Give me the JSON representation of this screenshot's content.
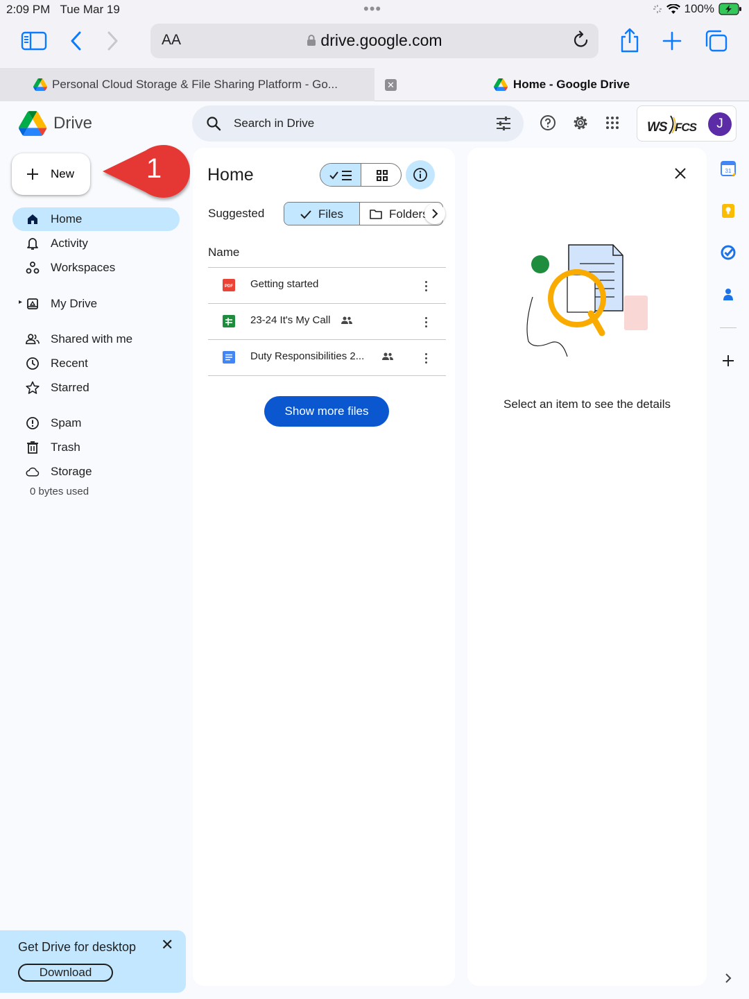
{
  "status_bar": {
    "time": "2:09 PM",
    "date": "Tue Mar 19",
    "battery": "100%"
  },
  "browser": {
    "aa_label": "AA",
    "url": "drive.google.com",
    "tabs": [
      {
        "title": "Personal Cloud Storage & File Sharing Platform - Go...",
        "active": false
      },
      {
        "title": "Home - Google Drive",
        "active": true
      }
    ]
  },
  "header": {
    "app_name": "Drive",
    "search_placeholder": "Search in Drive",
    "account_org": "WS FCS",
    "avatar_initial": "J"
  },
  "sidebar": {
    "new_label": "New",
    "callout_number": "1",
    "items": [
      {
        "label": "Home",
        "icon": "home-icon",
        "active": true
      },
      {
        "label": "Activity",
        "icon": "bell-icon"
      },
      {
        "label": "Workspaces",
        "icon": "workspaces-icon"
      },
      {
        "label": "My Drive",
        "icon": "my-drive-icon"
      },
      {
        "label": "Shared with me",
        "icon": "people-icon"
      },
      {
        "label": "Recent",
        "icon": "clock-icon"
      },
      {
        "label": "Starred",
        "icon": "star-icon"
      },
      {
        "label": "Spam",
        "icon": "spam-icon"
      },
      {
        "label": "Trash",
        "icon": "trash-icon"
      },
      {
        "label": "Storage",
        "icon": "cloud-icon"
      }
    ],
    "storage_used": "0 bytes used",
    "promo": {
      "title": "Get Drive for desktop",
      "download_label": "Download"
    }
  },
  "main": {
    "title": "Home",
    "suggested_label": "Suggested",
    "chips": {
      "files": "Files",
      "folders": "Folders"
    },
    "column_name": "Name",
    "files": [
      {
        "name": "Getting started",
        "type": "pdf",
        "shared": false
      },
      {
        "name": "23-24 It's My Call",
        "type": "sheets",
        "shared": true
      },
      {
        "name": "Duty Responsibilities 2...",
        "type": "docs",
        "shared": true
      }
    ],
    "show_more_label": "Show more files"
  },
  "details": {
    "message": "Select an item to see the details"
  },
  "colors": {
    "accent": "#0b57d0",
    "selected": "#c2e7ff",
    "safari_blue": "#0a7aff",
    "callout_red": "#e53935",
    "avatar": "#5b2ca6"
  }
}
